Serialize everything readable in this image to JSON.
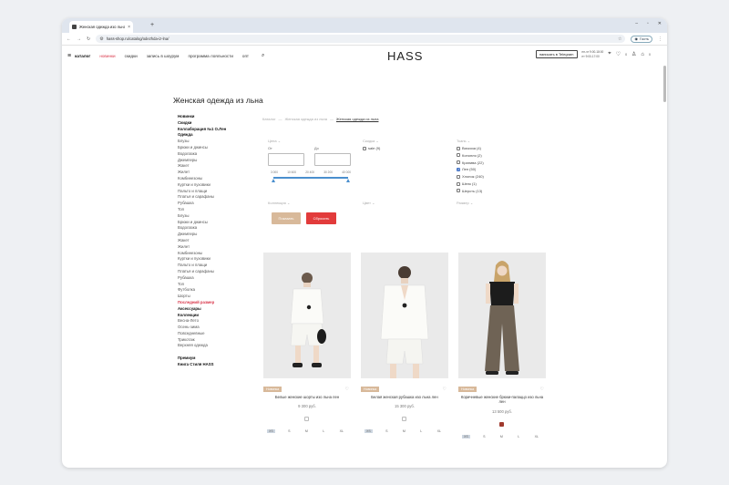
{
  "browser": {
    "tab_title": "Женская одежда изо льна в М",
    "url": "hass-shop.ru/catalog/odezhda-iz-lna/",
    "guest_label": "Гость"
  },
  "header": {
    "nav": [
      "каталог",
      "новинки",
      "скидки",
      "запись в шоурум",
      "программа лояльности",
      "опт"
    ],
    "logo": "HASS",
    "telegram_btn": "написать в Telegram",
    "hours_line1": "пн-чт 9:00-18:00",
    "hours_line2": "пт 9:00-17:00",
    "fav_count": "0",
    "cart_count": "0"
  },
  "page_title": "Женская одежда из льна",
  "sidebar": [
    {
      "label": "Новинки",
      "style": "bold"
    },
    {
      "label": "Скидки",
      "style": "bold"
    },
    {
      "label": "Коллаборация №1 О.Лен",
      "style": "bold"
    },
    {
      "label": "Одежда",
      "style": "bold"
    },
    {
      "label": "Блузы",
      "style": ""
    },
    {
      "label": "Брюки и джинсы",
      "style": ""
    },
    {
      "label": "Водолазка",
      "style": ""
    },
    {
      "label": "Джемперы",
      "style": ""
    },
    {
      "label": "Жакет",
      "style": ""
    },
    {
      "label": "Жилет",
      "style": ""
    },
    {
      "label": "Комбинезоны",
      "style": ""
    },
    {
      "label": "Куртки и пуховики",
      "style": ""
    },
    {
      "label": "Пальто и плащи",
      "style": ""
    },
    {
      "label": "Платья и сарафаны",
      "style": ""
    },
    {
      "label": "Рубашка",
      "style": ""
    },
    {
      "label": "Топ",
      "style": ""
    },
    {
      "label": "Блузы",
      "style": ""
    },
    {
      "label": "Брюки и джинсы",
      "style": ""
    },
    {
      "label": "Водолазка",
      "style": ""
    },
    {
      "label": "Джемперы",
      "style": ""
    },
    {
      "label": "Жакет",
      "style": ""
    },
    {
      "label": "Жилет",
      "style": ""
    },
    {
      "label": "Комбинезоны",
      "style": ""
    },
    {
      "label": "Куртки и пуховики",
      "style": ""
    },
    {
      "label": "Пальто и плащи",
      "style": ""
    },
    {
      "label": "Платья и сарафаны",
      "style": ""
    },
    {
      "label": "Рубашка",
      "style": ""
    },
    {
      "label": "Топ",
      "style": ""
    },
    {
      "label": "Футболка",
      "style": ""
    },
    {
      "label": "Шорты",
      "style": ""
    },
    {
      "label": "Последний размер",
      "style": "red"
    },
    {
      "label": "Аксессуары",
      "style": "bold"
    },
    {
      "label": "Коллекции",
      "style": "bold"
    },
    {
      "label": "Весна-Лето",
      "style": ""
    },
    {
      "label": "Осень-зима",
      "style": ""
    },
    {
      "label": "Повседневные",
      "style": ""
    },
    {
      "label": "Трикотаж",
      "style": ""
    },
    {
      "label": "Верхняя одежда",
      "style": ""
    },
    {
      "label": "",
      "style": ""
    },
    {
      "label": "Премиум",
      "style": "bold"
    },
    {
      "label": "Книга Стиля HASS",
      "style": "bold"
    }
  ],
  "breadcrumb": [
    "Каталог",
    "Женская одежда из льна",
    "Женская одежда из льна"
  ],
  "filters": {
    "price_label": "Цена",
    "from_label": "От",
    "to_label": "До",
    "price_scale": [
      "3 000",
      "10 600",
      "20 400",
      "30 200",
      "40 000"
    ],
    "sale_label": "Скидка",
    "sale_option": "sale (9)",
    "fabric_label": "Ткань",
    "fabrics": [
      {
        "label": "Вискоза (4)",
        "checked": false
      },
      {
        "label": "Конопля (2)",
        "checked": false
      },
      {
        "label": "Крапива (22)",
        "checked": false
      },
      {
        "label": "Лен (50)",
        "checked": true
      },
      {
        "label": "Хлопок (240)",
        "checked": false
      },
      {
        "label": "Шелк (1)",
        "checked": false
      },
      {
        "label": "Шерсть (13)",
        "checked": false
      }
    ],
    "collection_label": "Коллекция",
    "color_label": "Цвет",
    "size_label": "Размер",
    "apply_btn": "Показать",
    "reset_btn": "Сбросить"
  },
  "products": [
    {
      "badge": "Новинка",
      "name": "Белые женские шорты изо льна лен",
      "price": "9 300 руб.",
      "sizes": [
        "XS",
        "S",
        "M",
        "L",
        "XL"
      ],
      "swatch": "#ffffff"
    },
    {
      "badge": "Новинка",
      "name": "Белая женская рубашка изо льна лен",
      "price": "15 300 руб.",
      "sizes": [
        "XS",
        "S",
        "M",
        "L",
        "XL"
      ],
      "swatch": "#ffffff"
    },
    {
      "badge": "Новинка",
      "name": "Коричневые женские брюки-палаццо изо льна лен",
      "price": "13 500 руб.",
      "sizes": [
        "XS",
        "S",
        "M",
        "L",
        "XL"
      ],
      "swatch": "#a0392e"
    }
  ]
}
